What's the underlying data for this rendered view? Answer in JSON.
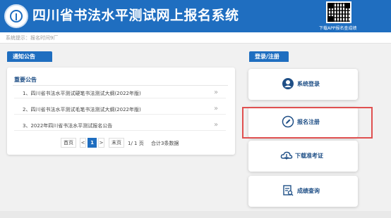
{
  "header": {
    "title": "四川省书法水平测试网上报名系统",
    "qr_caption": "下载APP报名查成绩",
    "logo_icon": "seal-logo-icon",
    "brand_color": "#1f6ec0"
  },
  "notice_bar": {
    "text": "系统提示：报名时间9厂"
  },
  "announcements": {
    "tab_label": "通知公告",
    "section_title": "重要公告",
    "items": [
      {
        "text": "1、四川省书法水平测试硬笔书法测试大纲(2022年版)"
      },
      {
        "text": "2、四川省书法水平测试毛笔书法测试大纲(2022年版)"
      },
      {
        "text": "3、2022年四川省书法水平测试报名公告"
      }
    ],
    "pagination": {
      "first": "首页",
      "prev": "<",
      "current": "1",
      "next": ">",
      "last": "末页",
      "page_info": "1/ 1 页",
      "total_info": "合计3条数据"
    }
  },
  "side": {
    "tab_label": "登录/注册",
    "buttons": [
      {
        "label": "系统登录",
        "icon": "user-icon"
      },
      {
        "label": "报名注册",
        "icon": "edit-icon"
      },
      {
        "label": "下载准考证",
        "icon": "cloud-download-icon"
      },
      {
        "label": "成绩查询",
        "icon": "document-search-icon"
      }
    ],
    "highlight_color": "#e05050"
  }
}
